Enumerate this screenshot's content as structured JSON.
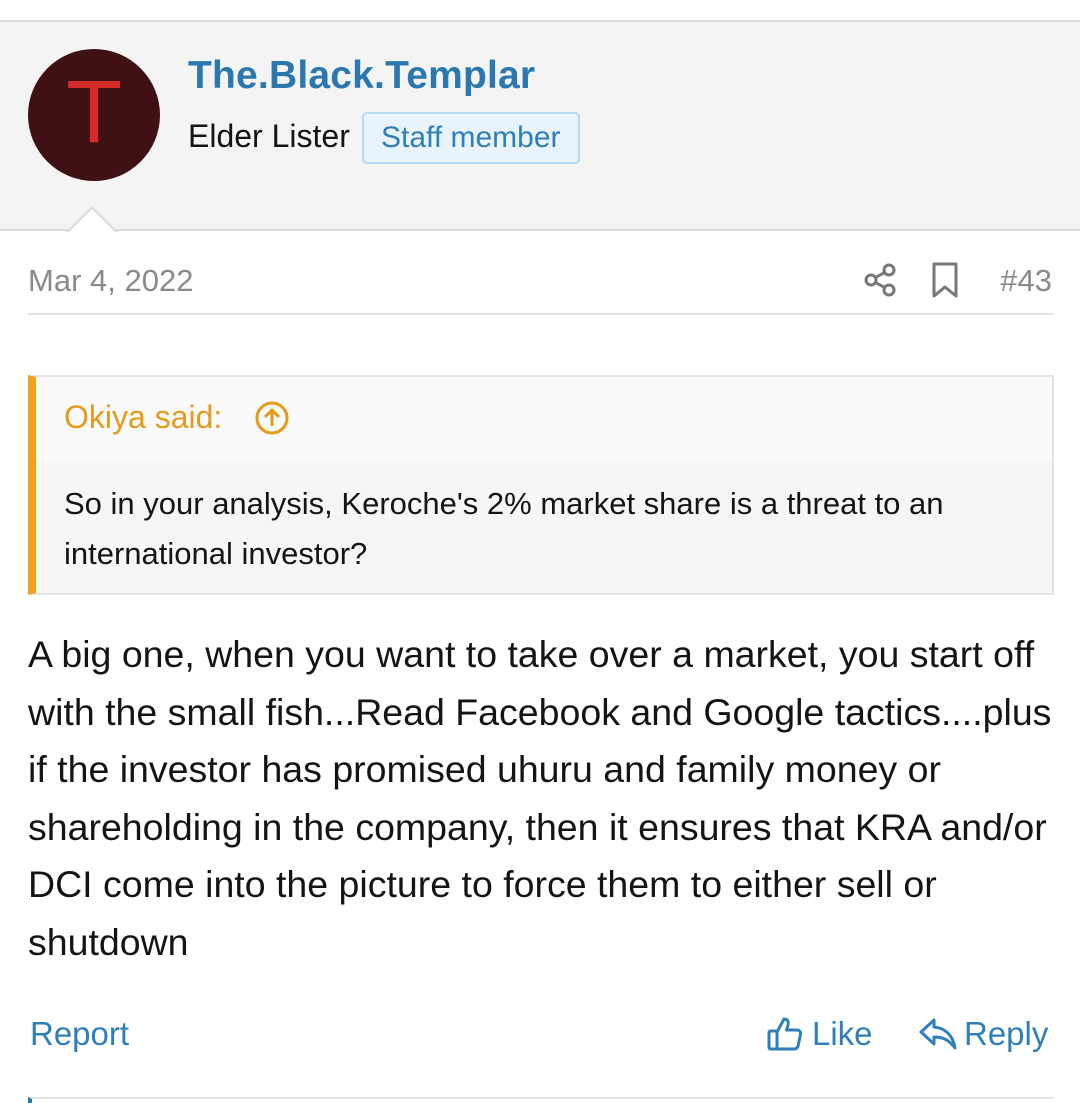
{
  "user": {
    "avatar_letter": "T",
    "avatar_bg": "#3f1014",
    "avatar_letter_color": "#d62b2b",
    "name": "The.Black.Templar",
    "title": "Elder Lister",
    "badge": "Staff member"
  },
  "post": {
    "date": "Mar 4, 2022",
    "number": "#43",
    "icons": [
      "share-icon",
      "bookmark-icon"
    ],
    "quote": {
      "author_label": "Okiya said:",
      "jump_icon": "arrow-up-circle-icon",
      "text": "So in your analysis, Keroche's 2% market share is a threat to an international investor?"
    },
    "body": "A big one, when you want to take over a market, you start off with the small fish...Read Facebook and Google tactics....plus if the investor has promised uhuru and family money or shareholding in the company, then it ensures that KRA and/or DCI come into the picture to force them to either sell or shutdown"
  },
  "actions": {
    "report": "Report",
    "like": "Like",
    "like_icon": "thumbs-up-icon",
    "reply": "Reply",
    "reply_icon": "reply-arrow-icon"
  },
  "colors": {
    "link": "#2f7fb9",
    "username": "#2b78b0",
    "quote_accent": "#f0a21e",
    "quote_author": "#e59a1c",
    "meta_text": "#8a8a8a"
  }
}
